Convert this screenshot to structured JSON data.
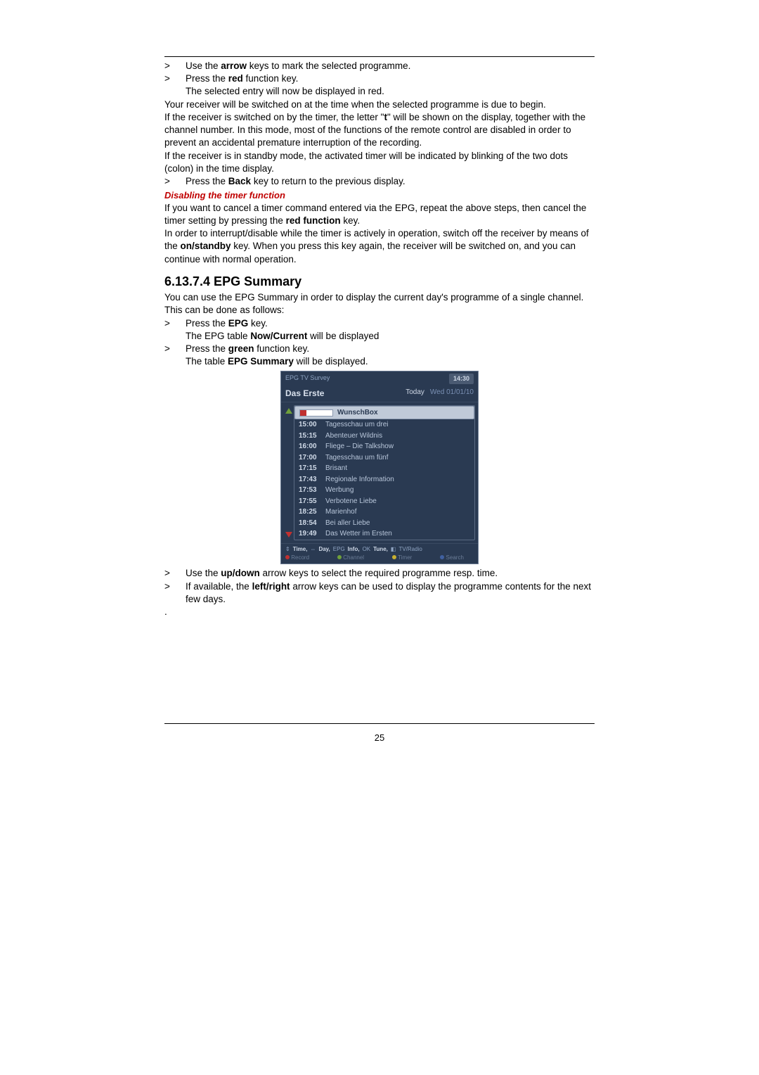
{
  "lines": {
    "l1_pre": "Use the ",
    "l1_b": "arrow",
    "l1_post": " keys to mark the selected programme.",
    "l2_pre": "Press the ",
    "l2_b": "red",
    "l2_post": " function key.",
    "l3": "The selected entry will now be displayed in red.",
    "p1": "Your receiver will be switched on at the time when the selected programme is due to begin.",
    "p2_pre": "If the receiver is switched on by the timer, the letter \"",
    "p2_b": "t",
    "p2_post": "\" will be shown on the display, together with the channel number. In this mode, most of the functions of the remote control are disabled in order to prevent an accidental premature interruption of the recording.",
    "p3": "If the receiver is in standby mode, the activated timer will be indicated by blinking of the two dots (colon) in the time display.",
    "l4_pre": "Press the ",
    "l4_b": "Back",
    "l4_post": " key to return to the previous display.",
    "sec_red": "Disabling the timer function",
    "p4_pre": "If you want to cancel a timer command entered via the EPG, repeat the above steps, then cancel the timer setting by pressing the ",
    "p4_b": "red function",
    "p4_post": " key.",
    "p5_pre": "In order to interrupt/disable while the timer is actively in operation, switch off the receiver by means of the ",
    "p5_b": "on/standby",
    "p5_post": " key. When you press this key again, the receiver will be switched on, and you can continue with normal operation.",
    "h3": "6.13.7.4 EPG Summary",
    "p6": "You can use the EPG Summary in order to display the current day's programme of a single channel. This can be done as follows:",
    "l5_pre": "Press the ",
    "l5_b": "EPG",
    "l5_post": " key.",
    "l6_pre": "The EPG table ",
    "l6_b": "Now/Current",
    "l6_post": " will be displayed",
    "l7_pre": "Press the ",
    "l7_b": "green",
    "l7_post": " function key.",
    "l8_pre": "The table ",
    "l8_b": "EPG Summary",
    "l8_post": " will be displayed.",
    "l9_pre": "Use the ",
    "l9_b": "up/down",
    "l9_post": " arrow keys to select the required programme resp. time.",
    "l10_pre": "If available, the ",
    "l10_b": "left/right",
    "l10_post": " arrow keys can be used to display the programme contents for the next few days.",
    "dot": "."
  },
  "epg": {
    "title": "EPG TV Survey",
    "clock": "14:30",
    "channel": "Das Erste",
    "today": "Today",
    "date": "Wed 01/01/10",
    "highlight": "WunschBox",
    "rows": [
      {
        "t": "15:00",
        "p": "Tagesschau um drei"
      },
      {
        "t": "15:15",
        "p": "Abenteuer Wildnis"
      },
      {
        "t": "16:00",
        "p": "Fliege – Die Talkshow"
      },
      {
        "t": "17:00",
        "p": "Tagesschau um fünf"
      },
      {
        "t": "17:15",
        "p": "Brisant"
      },
      {
        "t": "17:43",
        "p": "Regionale Information"
      },
      {
        "t": "17:53",
        "p": "Werbung"
      },
      {
        "t": "17:55",
        "p": "Verbotene Liebe"
      },
      {
        "t": "18:25",
        "p": "Marienhof"
      },
      {
        "t": "18:54",
        "p": "Bei aller Liebe"
      },
      {
        "t": "19:49",
        "p": "Das Wetter im Ersten"
      }
    ],
    "footer": {
      "f1a": "Time,",
      "f1b": "Day,",
      "f1c": "EPG",
      "f1d": "Info,",
      "f1e": "OK",
      "f1f": "Tune,",
      "f1g": "TV/Radio",
      "f2a": "Record",
      "f2b": "Channel",
      "f2c": "Timer",
      "f2d": "Search"
    }
  },
  "pageNumber": "25",
  "gt": ">"
}
